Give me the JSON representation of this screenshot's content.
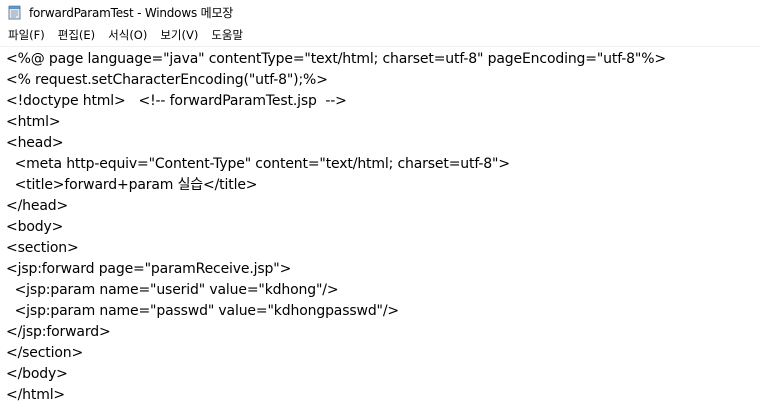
{
  "window": {
    "title": "forwardParamTest - Windows 메모장",
    "icon": "notepad-icon"
  },
  "menu": [
    {
      "label": "파일(F)"
    },
    {
      "label": "편집(E)"
    },
    {
      "label": "서식(O)"
    },
    {
      "label": "보기(V)"
    },
    {
      "label": "도움말"
    }
  ],
  "editor": {
    "lines": [
      "<%@ page language=\"java\" contentType=\"text/html; charset=utf-8\" pageEncoding=\"utf-8\"%>",
      "<% request.setCharacterEncoding(\"utf-8\");%>",
      "<!doctype html>   <!-- forwardParamTest.jsp  -->",
      "<html>",
      "<head>",
      "  <meta http-equiv=\"Content-Type\" content=\"text/html; charset=utf-8\">",
      "  <title>forward+param 실습</title>",
      "</head>",
      "<body>",
      "<section>",
      "<jsp:forward page=\"paramReceive.jsp\">",
      "  <jsp:param name=\"userid\" value=\"kdhong\"/>",
      "  <jsp:param name=\"passwd\" value=\"kdhongpasswd\"/>",
      "</jsp:forward>",
      "</section>",
      "</body>",
      "</html>"
    ]
  }
}
